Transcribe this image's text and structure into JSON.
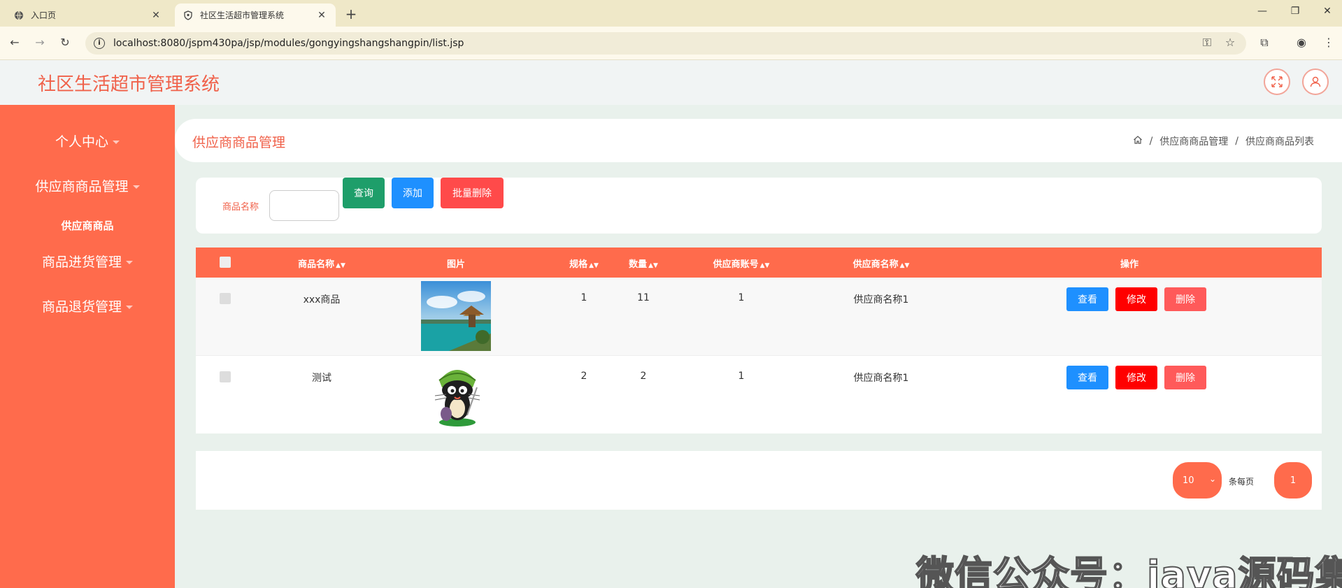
{
  "browser": {
    "tabs": [
      {
        "label": "入口页",
        "icon": "globe-icon"
      },
      {
        "label": "社区生活超市管理系统",
        "icon": "shield-icon"
      }
    ],
    "url": "localhost:8080/jspm430pa/jsp/modules/gongyingshangshangpin/list.jsp"
  },
  "header": {
    "title": "社区生活超市管理系统"
  },
  "sidebar": {
    "items": [
      {
        "label": "个人中心"
      },
      {
        "label": "供应商商品管理"
      },
      {
        "label": "商品进货管理"
      },
      {
        "label": "商品退货管理"
      }
    ],
    "subitems": [
      {
        "label": "供应商商品"
      }
    ]
  },
  "breadcrumb": {
    "page_title": "供应商商品管理",
    "path": [
      "供应商商品管理",
      "供应商商品列表"
    ]
  },
  "search": {
    "label": "商品名称",
    "value": "",
    "query_label": "查询",
    "add_label": "添加",
    "batch_delete_label": "批量删除"
  },
  "table": {
    "headers": [
      "商品名称",
      "图片",
      "规格",
      "数量",
      "供应商账号",
      "供应商名称",
      "操作"
    ],
    "rows": [
      {
        "name": "xxx商品",
        "spec": "1",
        "qty": "11",
        "account": "1",
        "supplier": "供应商名称1"
      },
      {
        "name": "测试",
        "spec": "2",
        "qty": "2",
        "account": "1",
        "supplier": "供应商名称1"
      }
    ],
    "actions": {
      "view": "查看",
      "edit": "修改",
      "delete": "删除"
    }
  },
  "pager": {
    "page_size": "10",
    "per_page_label": "条每页",
    "current_page": "1"
  },
  "watermark": "微信公众号：java源码集合",
  "colors": {
    "accent": "#ff6b4c",
    "title": "#f0614a",
    "query": "#1e9e6a",
    "add": "#1e90ff",
    "batch_delete": "#ff4a4a",
    "edit": "#ff0000",
    "delete": "#ff5a5a"
  }
}
